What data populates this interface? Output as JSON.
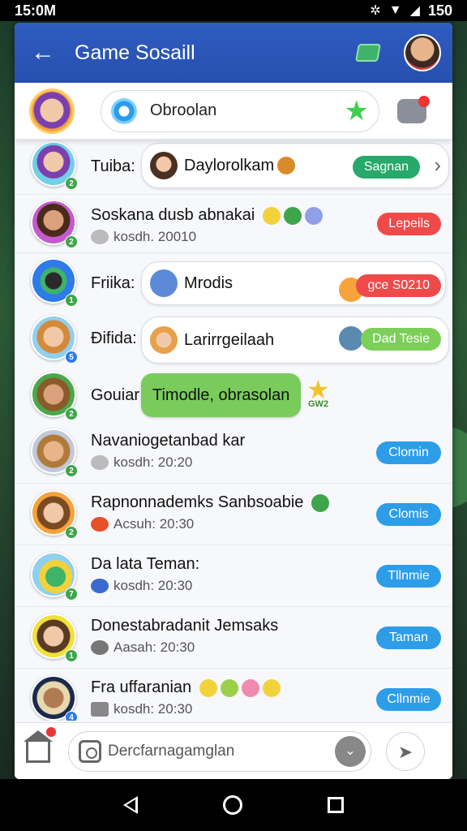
{
  "status_bar": {
    "time": "15:0M",
    "battery": "150"
  },
  "app_bar": {
    "title": "Game Sosaill"
  },
  "header": {
    "search_text": "Obroolan"
  },
  "rows": [
    {
      "name": "Tuiba:",
      "bubble_text": "Daylorolkam",
      "badge": "Sagnan",
      "badge_color": "#26a96b"
    },
    {
      "name": "Soskana dusb abnakai",
      "sub": "kosdh. 20010",
      "badge": "Lepeils",
      "badge_color": "#ef4a4a"
    },
    {
      "name": "Friika:",
      "bubble_text": "Mrodis",
      "badge": "gce S0210",
      "badge_color": "#ef4a4a"
    },
    {
      "name": "Đifida:",
      "bubble_text": "Larirrgeilaah",
      "badge": "Dad Tesie",
      "badge_color": "#7dcf5a"
    },
    {
      "name": "Gouiar",
      "bubble_text": "Timodle, obrasolan",
      "tag": "GW2"
    },
    {
      "name": "Navaniogetanbad kar",
      "sub": "kosdh: 20:20",
      "badge": "Clomin",
      "badge_color": "#2d9de8"
    },
    {
      "name": "Rapnonnademks Sanbsoabie",
      "sub": "Acsuh: 20:30",
      "badge": "Clomis",
      "badge_color": "#2d9de8"
    },
    {
      "name": "Da lata Teman:",
      "sub": "kosdh: 20:30",
      "badge": "Tllnmie",
      "badge_color": "#2d9de8"
    },
    {
      "name": "Donestabradanit Jemsaks",
      "sub": "Aasah: 20:30",
      "badge": "Taman",
      "badge_color": "#2d9de8"
    },
    {
      "name": "Fra uffaranian",
      "sub": "kosdh: 20:30",
      "badge": "Cllnmie",
      "badge_color": "#2d9de8"
    }
  ],
  "composer": {
    "placeholder": "Dercfarnagamglan"
  },
  "icons": [
    "back-arrow-icon",
    "map-icon",
    "gear-icon",
    "star-icon",
    "notification-icon",
    "home-icon",
    "camera-icon",
    "chevron-down-icon",
    "send-icon"
  ]
}
